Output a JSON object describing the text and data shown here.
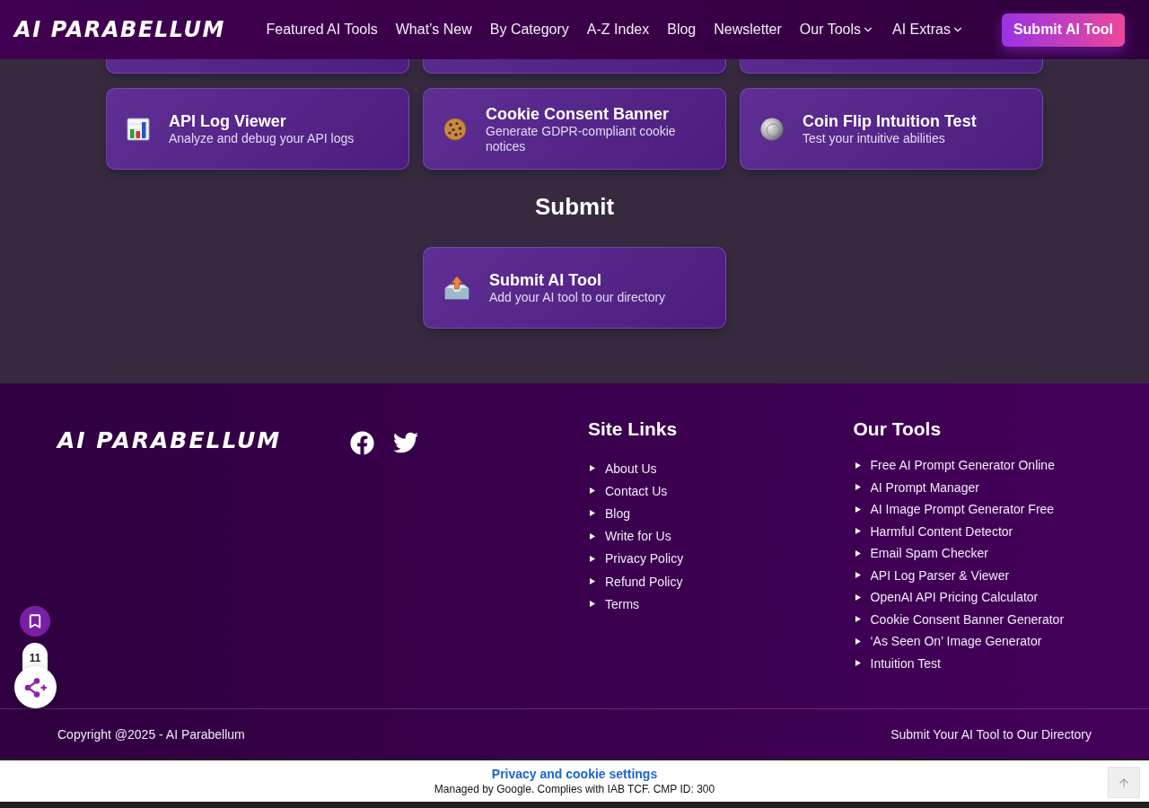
{
  "header": {
    "logo": "AI PARABELLUM",
    "nav": [
      {
        "label": "Featured AI Tools",
        "kind": "link"
      },
      {
        "label": "What’s New",
        "kind": "link"
      },
      {
        "label": "By Category",
        "kind": "link"
      },
      {
        "label": "A-Z Index",
        "kind": "link"
      },
      {
        "label": "Blog",
        "kind": "link"
      },
      {
        "label": "Newsletter",
        "kind": "link"
      },
      {
        "label": "Our Tools",
        "kind": "dropdown"
      },
      {
        "label": "AI Extras",
        "kind": "dropdown"
      }
    ],
    "button": "Submit AI Tool"
  },
  "tool_cards": [
    {
      "title": "API Log Viewer",
      "description": "Analyze and debug your API logs"
    },
    {
      "title": "Cookie Consent Banner",
      "description": "Generate GDPR-compliant cookie notices"
    },
    {
      "title": "Coin Flip Intuition Test",
      "description": "Test your intuitive abilities"
    }
  ],
  "submit_section": {
    "heading": "Submit",
    "cards": [
      {
        "title": "Submit AI Tool",
        "description": "Add your AI tool to our directory"
      }
    ]
  },
  "footer": {
    "logo": "AI PARABELLUM",
    "columns": [
      {
        "heading": "Site Links",
        "links": [
          "About Us",
          "Contact Us",
          "Blog",
          "Write for Us",
          "Privacy Policy",
          "Refund Policy",
          "Terms"
        ]
      },
      {
        "heading": "Our Tools",
        "links": [
          "Free AI Prompt Generator Online",
          "AI Prompt Manager",
          "AI Image Prompt Generator Free",
          "Harmful Content Detector",
          "Email Spam Checker",
          "API Log Parser & Viewer",
          "OpenAI API Pricing Calculator",
          "Cookie Consent Banner Generator",
          "‘As Seen On’ Image Generator",
          "Intuition Test"
        ]
      }
    ],
    "copyright": "Copyright @2025 - AI Parabellum",
    "bottom_link": "Submit Your AI Tool to Our Directory"
  },
  "share_widget": {
    "count": "11"
  },
  "consent_bar": {
    "link": "Privacy and cookie settings",
    "note": "Managed by Google. Complies with IAB TCF. CMP ID: 300"
  }
}
